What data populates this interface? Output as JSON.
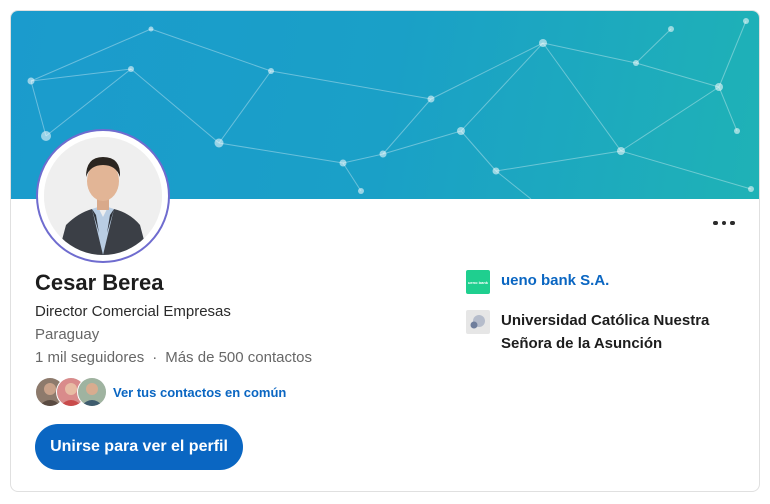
{
  "profile": {
    "name": "Cesar Berea",
    "headline": "Director Comercial Empresas",
    "location": "Paraguay",
    "followers": "1 mil seguidores",
    "separator": "·",
    "connections": "Más de 500 contactos"
  },
  "mutual": {
    "link_label": "Ver tus contactos en común"
  },
  "cta": {
    "join_label": "Unirse para ver el perfil"
  },
  "experience": {
    "company": "ueno bank S.A.",
    "company_logo_text": "ueno bank",
    "school": "Universidad Católica Nuestra Señora de la Asunción"
  },
  "icons": {
    "more": "more-horizontal-icon",
    "company_logo": "ueno-bank-logo",
    "school_logo": "school-logo"
  },
  "colors": {
    "accent": "#0a66c2",
    "banner_start": "#1b9bcd",
    "banner_end": "#1fb2b6",
    "avatar_ring": "#6f6ccf",
    "ueno_green": "#1fcf8f"
  }
}
